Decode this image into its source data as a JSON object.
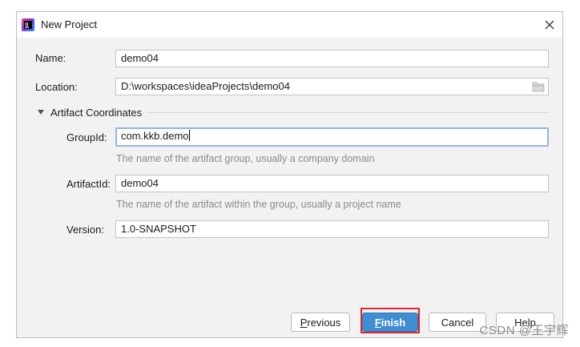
{
  "window": {
    "title": "New Project",
    "app_icon": "intellij-idea-icon",
    "close_icon": "close-icon"
  },
  "form": {
    "name": {
      "label": "Name:",
      "value": "demo04"
    },
    "location": {
      "label": "Location:",
      "value": "D:\\workspaces\\ideaProjects\\demo04",
      "browse_icon": "folder-icon"
    },
    "artifact_section": {
      "label": "Artifact Coordinates",
      "expanded": true
    },
    "group_id": {
      "label": "GroupId:",
      "value": "com.kkb.demo",
      "hint": "The name of the artifact group, usually a company domain"
    },
    "artifact_id": {
      "label": "ArtifactId:",
      "value": "demo04",
      "hint": "The name of the artifact within the group, usually a project name"
    },
    "version": {
      "label": "Version:",
      "value": "1.0-SNAPSHOT"
    }
  },
  "buttons": {
    "previous": {
      "mnemonic": "P",
      "rest": "revious"
    },
    "finish": {
      "mnemonic": "F",
      "rest": "inish"
    },
    "cancel": {
      "label": "Cancel"
    },
    "help": {
      "label": "Help"
    }
  },
  "watermark": "CSDN @王宇辉",
  "colors": {
    "primary_button": "#3f8ed4",
    "focus_border": "#8fb7e3",
    "annotation_box": "#e0262b",
    "dialog_bg": "#f2f2f2"
  }
}
